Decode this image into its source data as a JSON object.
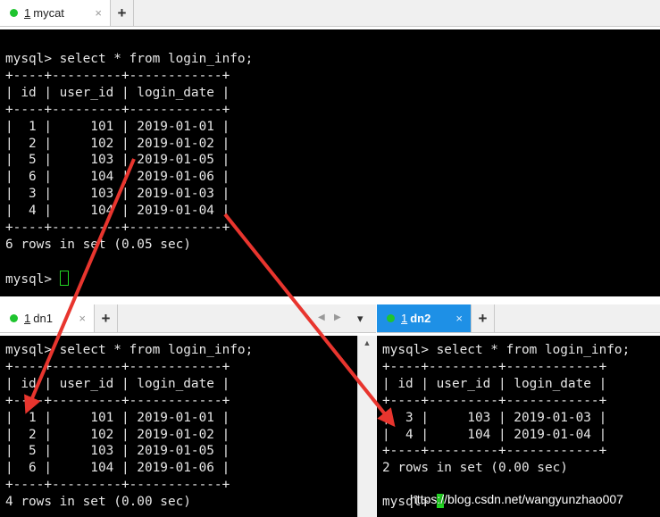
{
  "top_tab": {
    "index": "1",
    "title": "mycat",
    "close": "×"
  },
  "top_terminal": {
    "prompt": "mysql> ",
    "command": "select * from login_info;",
    "border": "+----+---------+------------+",
    "header": "| id | user_id | login_date |",
    "rows": [
      [
        "1",
        "101",
        "2019-01-01"
      ],
      [
        "2",
        "102",
        "2019-01-02"
      ],
      [
        "5",
        "103",
        "2019-01-05"
      ],
      [
        "6",
        "104",
        "2019-01-06"
      ],
      [
        "3",
        "103",
        "2019-01-03"
      ],
      [
        "4",
        "104",
        "2019-01-04"
      ]
    ],
    "summary": "6 rows in set (0.05 sec)",
    "final_prompt": "mysql> "
  },
  "left_tab": {
    "index": "1",
    "title": "dn1",
    "close": "×"
  },
  "left_terminal": {
    "prompt": "mysql> ",
    "command": "select * from login_info;",
    "border": "+----+---------+------------+",
    "header": "| id | user_id | login_date |",
    "rows": [
      [
        "1",
        "101",
        "2019-01-01"
      ],
      [
        "2",
        "102",
        "2019-01-02"
      ],
      [
        "5",
        "103",
        "2019-01-05"
      ],
      [
        "6",
        "104",
        "2019-01-06"
      ]
    ],
    "summary": "4 rows in set (0.00 sec)"
  },
  "right_tab": {
    "index": "1",
    "title": "dn2",
    "close": "×"
  },
  "right_terminal": {
    "prompt": "mysql> ",
    "command": "select * from login_info;",
    "border": "+----+---------+------------+",
    "header": "| id | user_id | login_date |",
    "rows": [
      [
        "3",
        "103",
        "2019-01-03"
      ],
      [
        "4",
        "104",
        "2019-01-04"
      ]
    ],
    "summary": "2 rows in set (0.00 sec)",
    "final_prompt": "mysql> "
  },
  "plus_label": "+",
  "nav": {
    "left": "◀",
    "right": "▶",
    "dropdown": "▾"
  },
  "scroll_up": "▲",
  "watermark": "https://blog.csdn.net/wangyunzhao007",
  "colors": {
    "accent_tab": "#1e90e6",
    "status_dot": "#1fc42f",
    "arrow": "#e8352e",
    "cursor": "#22d622"
  }
}
